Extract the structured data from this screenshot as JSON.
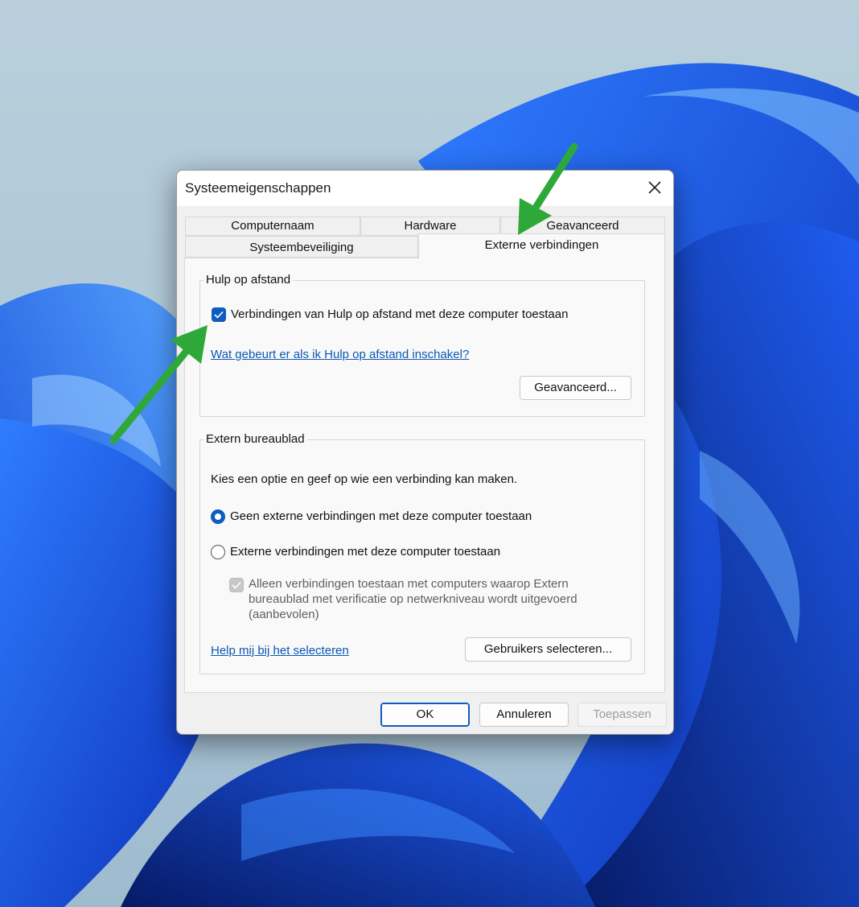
{
  "dialog": {
    "title": "Systeemeigenschappen",
    "close_icon": "close-icon"
  },
  "tabs": {
    "row1": [
      "Computernaam",
      "Hardware",
      "Geavanceerd"
    ],
    "row2": [
      "Systeembeveiliging",
      "Externe verbindingen"
    ],
    "active": "Externe verbindingen"
  },
  "remote_assistance": {
    "legend": "Hulp op afstand",
    "checkbox_label": "Verbindingen van Hulp op afstand met deze computer toestaan",
    "checkbox_checked": true,
    "help_link": "Wat gebeurt er als ik Hulp op afstand inschakel?",
    "advanced_button": "Geavanceerd..."
  },
  "remote_desktop": {
    "legend": "Extern bureaublad",
    "intro": "Kies een optie en geef op wie een verbinding kan maken.",
    "option_none": "Geen externe verbindingen met deze computer toestaan",
    "option_allow": "Externe verbindingen met deze computer toestaan",
    "selected_option": "Geen externe verbindingen met deze computer toestaan",
    "nla_line1": "Alleen verbindingen toestaan met computers waarop Extern",
    "nla_line2": "bureaublad met verificatie op netwerkniveau wordt uitgevoerd",
    "nla_line3": "(aanbevolen)",
    "nla_checked": true,
    "nla_disabled": true,
    "help_link": "Help mij bij het selecteren",
    "select_users_button": "Gebruikers selecteren..."
  },
  "footer": {
    "ok": "OK",
    "cancel": "Annuleren",
    "apply": "Toepassen"
  },
  "colors": {
    "accent": "#0f5cc0",
    "annotation_arrow": "#2fa83a",
    "link": "#0b57b4"
  }
}
